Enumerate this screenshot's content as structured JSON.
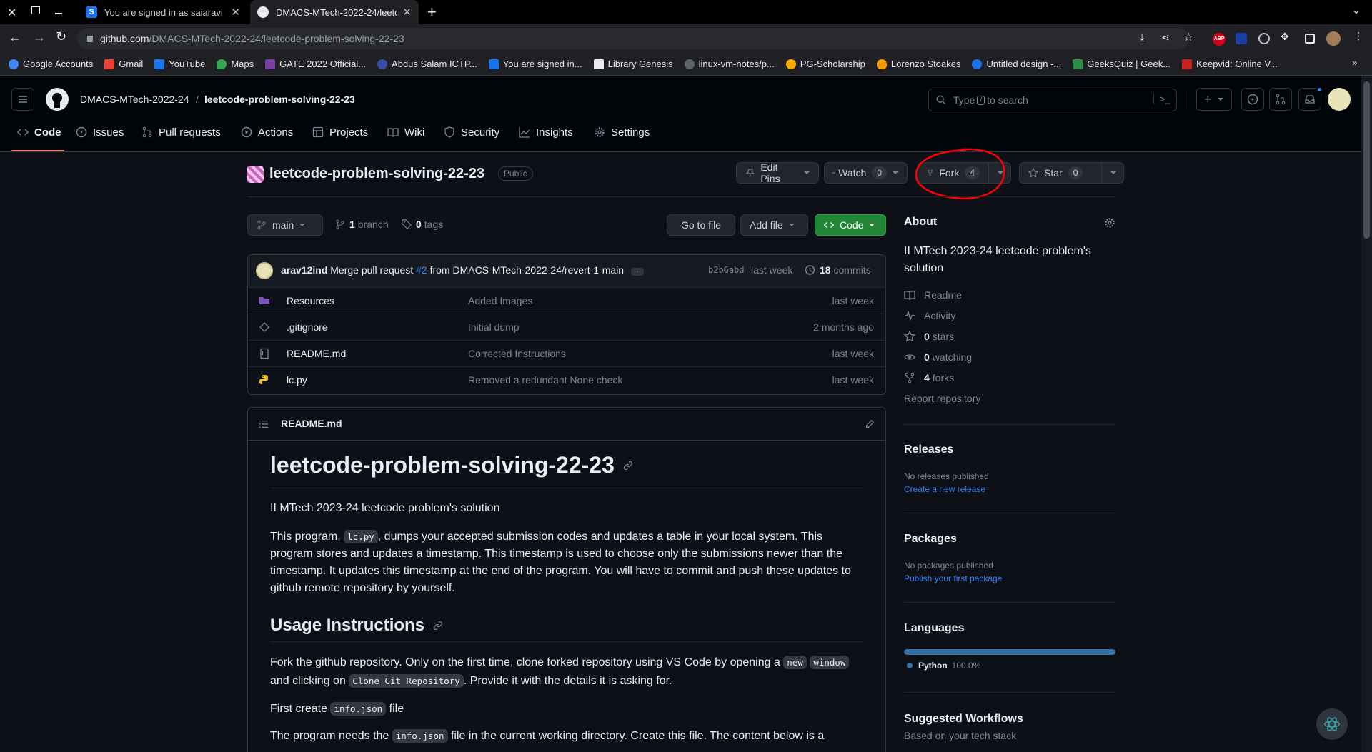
{
  "browser": {
    "tabs": [
      {
        "title": "You are signed in as saiaravi"
      },
      {
        "title": "DMACS-MTech-2022-24/leetc"
      }
    ],
    "url_domain": "github.com",
    "url_path": "/DMACS-MTech-2022-24/leetcode-problem-solving-22-23",
    "bookmarks": [
      "Google Accounts",
      "Gmail",
      "YouTube",
      "Maps",
      "GATE 2022 Official...",
      "Abdus Salam ICTP...",
      "You are signed in...",
      "Library Genesis",
      "linux-vm-notes/p...",
      "PG-Scholarship",
      "Lorenzo Stoakes",
      "Untitled design -...",
      "GeeksQuiz | Geek...",
      "Keepvid: Online V..."
    ],
    "ext_abp": "ABP"
  },
  "header": {
    "owner": "DMACS-MTech-2022-24",
    "separator": "/",
    "repo": "leetcode-problem-solving-22-23",
    "search_prefix": "Type",
    "search_key": "/",
    "search_suffix": "to search",
    "plus": "+"
  },
  "nav": {
    "code": "Code",
    "issues": "Issues",
    "pulls": "Pull requests",
    "actions": "Actions",
    "projects": "Projects",
    "wiki": "Wiki",
    "security": "Security",
    "insights": "Insights",
    "settings": "Settings"
  },
  "repo": {
    "name": "leetcode-problem-solving-22-23",
    "visibility": "Public",
    "edit_pins": "Edit Pins",
    "watch": "Watch",
    "watch_count": "0",
    "fork": "Fork",
    "fork_count": "4",
    "star": "Star",
    "star_count": "0"
  },
  "toolbar": {
    "branch": "main",
    "branch_count": "1",
    "branch_label": "branch",
    "tag_count": "0",
    "tag_label": "tags",
    "go_to_file": "Go to file",
    "add_file": "Add file",
    "code": "Code"
  },
  "commit": {
    "author": "arav12ind",
    "msg_pre": "Merge pull request",
    "pr": "#2",
    "msg_post": "from DMACS-MTech-2022-24/revert-1-main",
    "ellipsis": "···",
    "sha": "b2b6abd",
    "when": "last week",
    "count": "18",
    "count_label": "commits"
  },
  "files": [
    {
      "name": "Resources",
      "message": "Added Images",
      "date": "last week",
      "kind": "folder"
    },
    {
      "name": ".gitignore",
      "message": "Initial dump",
      "date": "2 months ago",
      "kind": "file"
    },
    {
      "name": "README.md",
      "message": "Corrected Instructions",
      "date": "last week",
      "kind": "readme"
    },
    {
      "name": "lc.py",
      "message": "Removed a redundant None check",
      "date": "last week",
      "kind": "python"
    }
  ],
  "readme": {
    "filename": "README.md",
    "h1": "leetcode-problem-solving-22-23",
    "p1": "II MTech 2023-24 leetcode problem's solution",
    "p2_a": "This program, ",
    "p2_code": "lc.py",
    "p2_b": ", dumps your accepted submission codes and updates a table in your local system. This program stores and updates a timestamp. This timestamp is used to choose only the submissions newer than the timestamp. It updates this timestamp at the end of the program. You will have to commit and push these updates to github remote repository by yourself.",
    "h2": "Usage Instructions",
    "p3_a": "Fork the github repository. Only on the first time, clone forked repository using VS Code by opening a ",
    "p3_code1a": "new",
    "p3_code1b": "window",
    "p3_b": " and clicking on ",
    "p3_code2": "Clone Git Repository",
    "p3_c": ". Provide it with the details it is asking for.",
    "p4_a": "First create ",
    "p4_code": "info.json",
    "p4_b": " file",
    "p5_a": "The program needs the ",
    "p5_code": "info.json",
    "p5_b": " file in the current working directory. Create this file. The content below is a"
  },
  "about": {
    "title": "About",
    "description": "II MTech 2023-24 leetcode problem's solution",
    "readme": "Readme",
    "activity": "Activity",
    "stars_count": "0",
    "stars_label": "stars",
    "watching_count": "0",
    "watching_label": "watching",
    "forks_count": "4",
    "forks_label": "forks",
    "report": "Report repository"
  },
  "releases": {
    "title": "Releases",
    "none": "No releases published",
    "create": "Create a new release"
  },
  "packages": {
    "title": "Packages",
    "none": "No packages published",
    "publish": "Publish your first package"
  },
  "languages": {
    "title": "Languages",
    "items": [
      {
        "name": "Python",
        "percent": "100.0%",
        "fraction": 1.0
      }
    ]
  },
  "workflows": {
    "title": "Suggested Workflows",
    "subtitle": "Based on your tech stack"
  },
  "colors": {
    "accent": "#2f81f7",
    "green": "#238636",
    "python": "#3572A5",
    "annotation": "#ff0000"
  }
}
